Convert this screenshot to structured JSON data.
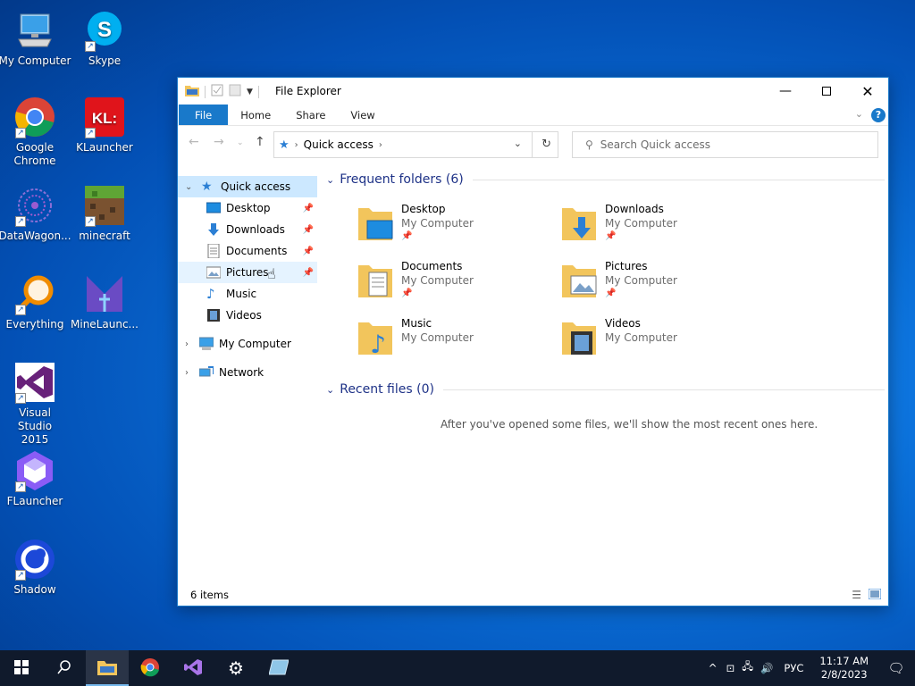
{
  "desktop": {
    "icons": [
      {
        "label": "My Computer"
      },
      {
        "label": "Skype"
      },
      {
        "label": "Google Chrome"
      },
      {
        "label": "KLauncher"
      },
      {
        "label": "DataWagon..."
      },
      {
        "label": "minecraft"
      },
      {
        "label": "Everything"
      },
      {
        "label": "MineLaunc..."
      },
      {
        "label": "Visual Studio 2015"
      },
      {
        "label": "FLauncher"
      },
      {
        "label": "Shadow"
      }
    ]
  },
  "window": {
    "title": "File Explorer",
    "ribbon_tabs": [
      "File",
      "Home",
      "Share",
      "View"
    ],
    "address": "Quick access",
    "search_placeholder": "Search Quick access",
    "nav": {
      "quick_access": "Quick access",
      "items": [
        "Desktop",
        "Downloads",
        "Documents",
        "Pictures",
        "Music",
        "Videos"
      ],
      "my_computer": "My Computer",
      "network": "Network"
    },
    "frequent_header": "Frequent folders (6)",
    "folders": [
      {
        "name": "Desktop",
        "location": "My Computer"
      },
      {
        "name": "Downloads",
        "location": "My Computer"
      },
      {
        "name": "Documents",
        "location": "My Computer"
      },
      {
        "name": "Pictures",
        "location": "My Computer"
      },
      {
        "name": "Music",
        "location": "My Computer"
      },
      {
        "name": "Videos",
        "location": "My Computer"
      }
    ],
    "recent_header": "Recent files (0)",
    "recent_empty": "After you've opened some files, we'll show the most recent ones here.",
    "status": "6 items"
  },
  "taskbar": {
    "lang": "РУС",
    "time": "11:17 AM",
    "date": "2/8/2023"
  }
}
